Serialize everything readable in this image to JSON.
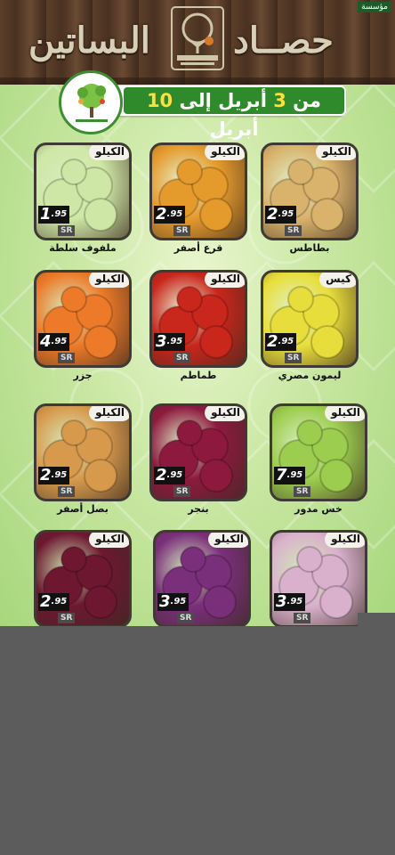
{
  "header": {
    "brand_part1": "حصــاد",
    "brand_part2": "البساتين",
    "top_tag": "مؤسسة",
    "date_from_word": "من",
    "date_from_num": "3",
    "date_mid": "أبريل إلى",
    "date_to_num": "10",
    "date_to_word": "أبريل"
  },
  "products": [
    {
      "name": "ملفوف سلطة",
      "unit": "الكيلو",
      "price_int": "1",
      "price_dec": ".95",
      "currency": "SR",
      "color": "#cfe7a6"
    },
    {
      "name": "قرع أصفر",
      "unit": "الكيلو",
      "price_int": "2",
      "price_dec": ".95",
      "currency": "SR",
      "color": "#e59a2c"
    },
    {
      "name": "بطاطس",
      "unit": "الكيلو",
      "price_int": "2",
      "price_dec": ".95",
      "currency": "SR",
      "color": "#d9b26c"
    },
    {
      "name": "جزر",
      "unit": "الكيلو",
      "price_int": "4",
      "price_dec": ".95",
      "currency": "SR",
      "color": "#ec7a28"
    },
    {
      "name": "طماطم",
      "unit": "الكيلو",
      "price_int": "3",
      "price_dec": ".95",
      "currency": "SR",
      "color": "#c9261c"
    },
    {
      "name": "ليمون مصري",
      "unit": "كيس",
      "price_int": "2",
      "price_dec": ".95",
      "currency": "SR",
      "color": "#e8de3b"
    },
    {
      "name": "بصل أصفر",
      "unit": "الكيلو",
      "price_int": "2",
      "price_dec": ".95",
      "currency": "SR",
      "color": "#d79a4d"
    },
    {
      "name": "بنجر",
      "unit": "الكيلو",
      "price_int": "2",
      "price_dec": ".95",
      "currency": "SR",
      "color": "#8d1a3e"
    },
    {
      "name": "خس مدور",
      "unit": "الكيلو",
      "price_int": "7",
      "price_dec": ".95",
      "currency": "SR",
      "color": "#9ccd4e"
    },
    {
      "name": "",
      "unit": "الكيلو",
      "price_int": "2",
      "price_dec": ".95",
      "currency": "SR",
      "color": "#6d1830"
    },
    {
      "name": "",
      "unit": "الكيلو",
      "price_int": "3",
      "price_dec": ".95",
      "currency": "SR",
      "color": "#7a2f7a"
    },
    {
      "name": "",
      "unit": "الكيلو",
      "price_int": "3",
      "price_dec": ".95",
      "currency": "SR",
      "color": "#d9b1cc"
    }
  ]
}
